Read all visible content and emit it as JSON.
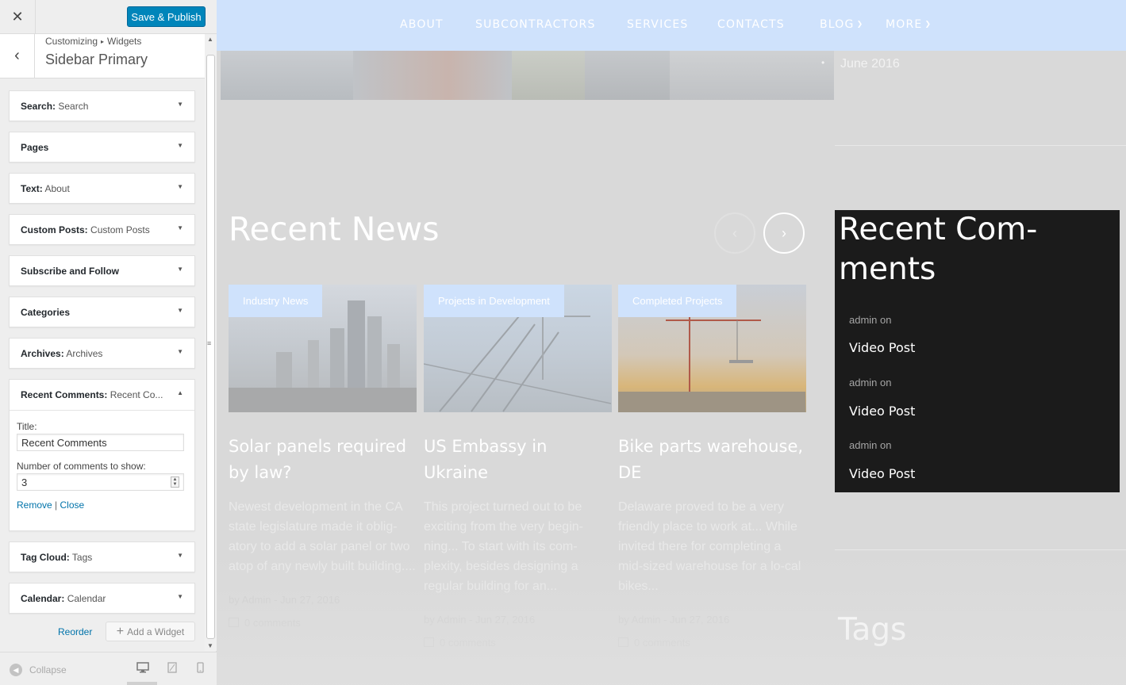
{
  "customizer": {
    "close_icon": "close-icon",
    "save_label": "Save & Publish",
    "breadcrumb_a": "Customizing",
    "breadcrumb_b": "Widgets",
    "section_title": "Sidebar Primary",
    "widgets": [
      {
        "name": "Search:",
        "sub": "Search"
      },
      {
        "name": "Pages",
        "sub": ""
      },
      {
        "name": "Text:",
        "sub": "About"
      },
      {
        "name": "Custom Posts:",
        "sub": "Custom Posts"
      },
      {
        "name": "Subscribe and Follow",
        "sub": ""
      },
      {
        "name": "Categories",
        "sub": ""
      },
      {
        "name": "Archives:",
        "sub": "Archives"
      },
      {
        "name": "Recent Comments:",
        "sub": "Recent Co..."
      },
      {
        "name": "Tag Cloud:",
        "sub": "Tags"
      },
      {
        "name": "Calendar:",
        "sub": "Calendar"
      }
    ],
    "open_widget": {
      "title_label": "Title:",
      "title_value": "Recent Comments",
      "count_label": "Number of comments to show:",
      "count_value": "3",
      "remove_label": "Remove",
      "separator": "|",
      "close_label": "Close"
    },
    "reorder_label": "Reorder",
    "add_widget_label": "Add a Widget",
    "collapse_label": "Collapse",
    "devices": [
      "desktop-icon",
      "tablet-icon",
      "mobile-icon"
    ]
  },
  "preview": {
    "nav": [
      "ABOUT",
      "SUBCONTRACTORS",
      "SERVICES",
      "CONTACTS",
      "BLOG",
      "MORE"
    ],
    "archive_item": "June 2016",
    "recent_news_title": "Recent News",
    "cards": [
      {
        "tag": "Industry News",
        "title": "Solar panels required by law?",
        "excerpt": "Newest development in the CA state legislature made it oblig-atory to add a solar panel or two atop of any newly built building....",
        "meta": "by Admin - Jun 27, 2016",
        "comments": "0 comments"
      },
      {
        "tag": "Projects in Development",
        "title": "US Embassy in Ukraine",
        "excerpt": "This project turned out to be exciting from the very begin-ning... To start with its com-plexity, besides designing a regular building for an...",
        "meta": "by Admin - Jun 27, 2016",
        "comments": "0 comments"
      },
      {
        "tag": "Completed Projects",
        "title": "Bike parts warehouse, DE",
        "excerpt": "Delaware proved to be a very friendly place to work at... While invited there for completing a mid-sized warehouse for a lo-cal bikes...",
        "meta": "by Admin - Jun 27, 2016",
        "comments": "0 comments"
      }
    ],
    "recent_comments_title": "Recent Com-ments",
    "comments": [
      {
        "author": "admin on",
        "post": "Video Post"
      },
      {
        "author": "admin on",
        "post": "Video Post"
      },
      {
        "author": "admin on",
        "post": "Video Post"
      }
    ],
    "tags_title": "Tags"
  }
}
